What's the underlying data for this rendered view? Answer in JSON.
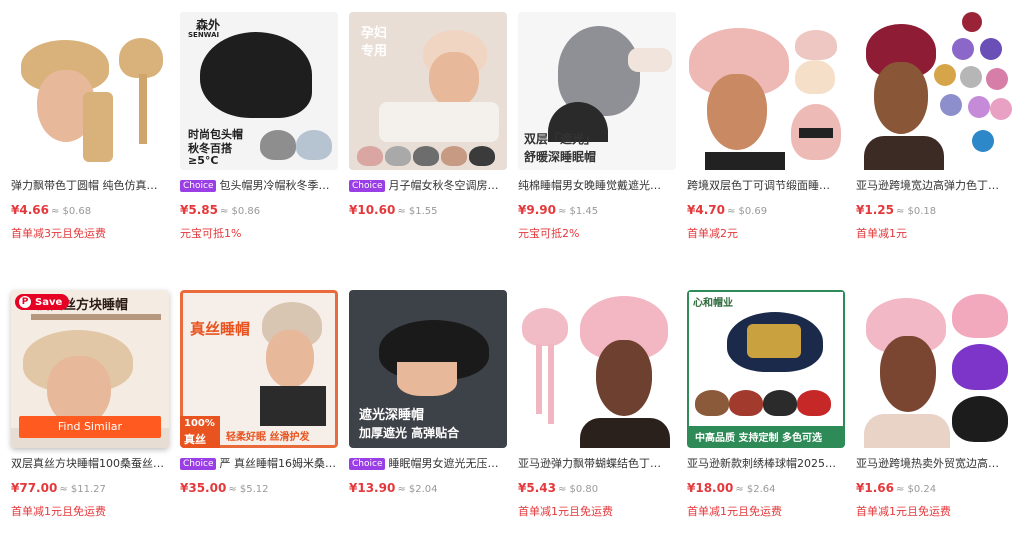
{
  "products": [
    {
      "title": "弹力飘带色丁圆帽 纯色仿真…",
      "choice": false,
      "price": "¥4.66",
      "approx": "≈ $0.68",
      "promo": "首单减3元且免运费",
      "overlay": []
    },
    {
      "title": "包头帽男冷帽秋冬季…",
      "choice": true,
      "choice_label": "Choice",
      "price": "¥5.85",
      "approx": "≈ $0.86",
      "promo": "元宝可抵1%",
      "overlay": [
        "森外",
        "SENWAI",
        "时尚包头帽",
        "秋冬百搭",
        "≥5°C"
      ]
    },
    {
      "title": "月子帽女秋冬空调房…",
      "choice": true,
      "choice_label": "Choice",
      "price": "¥10.60",
      "approx": "≈ $1.55",
      "promo": "",
      "overlay": [
        "孕妇",
        "专用"
      ]
    },
    {
      "title": "纯棉睡帽男女晚睡觉戴遮光…",
      "choice": false,
      "price": "¥9.90",
      "approx": "≈ $1.45",
      "promo": "元宝可抵2%",
      "overlay": [
        "双层「遮光」",
        "舒暖深睡眠帽"
      ]
    },
    {
      "title": "跨境双层色丁可调节缎面睡…",
      "choice": false,
      "price": "¥4.70",
      "approx": "≈ $0.69",
      "promo": "首单减2元",
      "overlay": []
    },
    {
      "title": "亚马逊跨境宽边高弹力色丁…",
      "choice": false,
      "price": "¥1.25",
      "approx": "≈ $0.18",
      "promo": "首单减1元",
      "overlay": []
    },
    {
      "title": "双层真丝方块睡帽100桑蚕丝…",
      "choice": false,
      "price": "¥77.00",
      "approx": "≈ $11.27",
      "promo": "首单减1元且免运费",
      "overlay": [
        "层真丝方块睡帽"
      ],
      "save_label": "Save",
      "find_similar": "Find Similar"
    },
    {
      "title": "严 真丝睡帽16姆米桑…",
      "choice": true,
      "choice_label": "Choice",
      "price": "¥35.00",
      "approx": "≈ $5.12",
      "promo": "",
      "overlay": [
        "真丝睡帽",
        "100%",
        "真丝",
        "轻柔好眠 丝滑护发"
      ]
    },
    {
      "title": "睡眠帽男女遮光无压…",
      "choice": true,
      "choice_label": "Choice",
      "price": "¥13.90",
      "approx": "≈ $2.04",
      "promo": "",
      "overlay": [
        "遮光深睡帽",
        "加厚遮光 高弹贴合"
      ]
    },
    {
      "title": "亚马逊弹力飘带蝴蝶结色丁…",
      "choice": false,
      "price": "¥5.43",
      "approx": "≈ $0.80",
      "promo": "首单减1元且免运费",
      "overlay": []
    },
    {
      "title": "亚马逊新款刺绣棒球帽2025…",
      "choice": false,
      "price": "¥18.00",
      "approx": "≈ $2.64",
      "promo": "首单减1元且免运费",
      "overlay": [
        "心和帽业",
        "中高品质  支持定制  多色可选"
      ]
    },
    {
      "title": "亚马逊跨境热卖外贸宽边高…",
      "choice": false,
      "price": "¥1.66",
      "approx": "≈ $0.24",
      "promo": "首单减1元且免运费",
      "overlay": []
    }
  ],
  "colors": {
    "price": "#e4393c",
    "choice": "#9a3ee6",
    "find_similar": "#ff5a1f",
    "save": "#e60023"
  }
}
